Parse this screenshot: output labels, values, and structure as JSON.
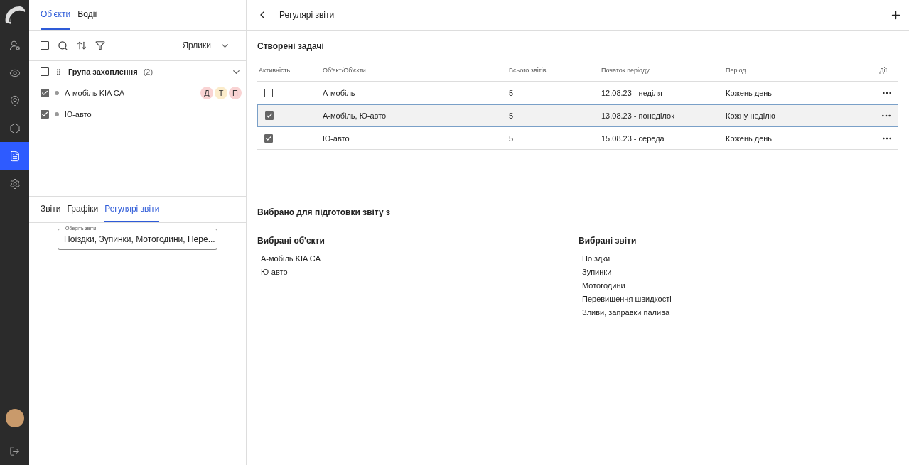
{
  "nav": {
    "items": [
      {
        "kind": "users",
        "selected": false
      },
      {
        "kind": "eye",
        "selected": false
      },
      {
        "kind": "pin",
        "selected": false
      },
      {
        "kind": "hex",
        "selected": false
      },
      {
        "kind": "doc",
        "selected": true
      },
      {
        "kind": "gear",
        "selected": false
      }
    ]
  },
  "object_tabs": [
    {
      "label": "Об'єкти",
      "selected": true
    },
    {
      "label": "Водії",
      "selected": false
    }
  ],
  "toolbar": {
    "select_all_checked": false,
    "labels_dropdown": "Ярлики"
  },
  "group": {
    "name": "Група захоплення",
    "count": "(2)",
    "checked": false,
    "expanded": true,
    "children": [
      {
        "name": "А-мобіль KIA CA",
        "checked": true,
        "tags": [
          {
            "label": "Д",
            "color": "#f9d3d3"
          },
          {
            "label": "Т",
            "color": "#fbeccb"
          },
          {
            "label": "П",
            "color": "#f9d3d3"
          }
        ]
      },
      {
        "name": "Ю-авто",
        "checked": true
      }
    ]
  },
  "report_tabs": [
    {
      "label": "Звіти",
      "selected": false
    },
    {
      "label": "Графіки",
      "selected": false
    },
    {
      "label": "Регулярі звіти",
      "selected": true
    }
  ],
  "report_select": {
    "label": "Оберіть звіти",
    "value": "Поїздки, Зупинки, Мотогодини, Пере..."
  },
  "header": {
    "title": "Регулярі звіти"
  },
  "tasks": {
    "title": "Створені задачі",
    "columns": [
      "Активність",
      "Об'єкт/Об'єкти",
      "Всього звітів",
      "Початок періоду",
      "Період",
      "Дії"
    ],
    "rows": [
      {
        "active": false,
        "selected": false,
        "objects": "А-мобіль",
        "total": "5",
        "start": "12.08.23 - неділя",
        "period": "Кожень день"
      },
      {
        "active": true,
        "selected": true,
        "objects": "А-мобіль, Ю-авто",
        "total": "5",
        "start": "13.08.23 - понеділок",
        "period": "Кожну неділю"
      },
      {
        "active": true,
        "selected": false,
        "objects": "Ю-авто",
        "total": "5",
        "start": "15.08.23 - середа",
        "period": "Кожень день"
      }
    ]
  },
  "summary": {
    "title": "Вибрано для підготовки звіту з",
    "objects_title": "Вибрані об'єкти",
    "objects": [
      "А-мобіль KIA CA",
      "Ю-авто"
    ],
    "reports_title": "Вибрані звіти",
    "reports": [
      "Поїздки",
      "Зупинки",
      "Мотогодини",
      "Перевищення швидкості",
      "Зливи, заправки палива"
    ]
  }
}
